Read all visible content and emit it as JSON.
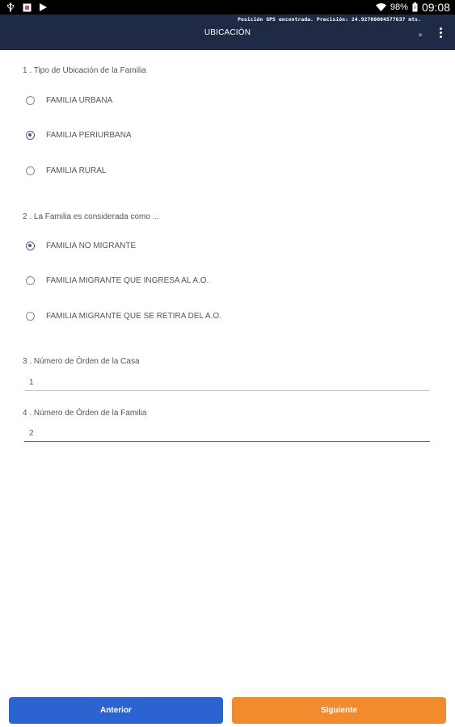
{
  "status_bar": {
    "battery": "98%",
    "time": "09:08"
  },
  "app_bar": {
    "gps_message": "Posición GPS encontrada. Precisión: 24.92700004577637 mts.",
    "title": "UBICACIÓN"
  },
  "questions": [
    {
      "title": "1 . Tipo de Ubicación de la Familia",
      "options": [
        {
          "label": "FAMILIA URBANA",
          "selected": false
        },
        {
          "label": "FAMILIA PERIURBANA",
          "selected": true
        },
        {
          "label": "FAMILIA RURAL",
          "selected": false
        }
      ]
    },
    {
      "title": "2 . La Familia es considerada como ...",
      "options": [
        {
          "label": "FAMILIA NO MIGRANTE",
          "selected": true
        },
        {
          "label": "FAMILIA MIGRANTE QUE INGRESA AL A.O.",
          "selected": false
        },
        {
          "label": "FAMILIA MIGRANTE QUE SE RETIRA DEL A.O.",
          "selected": false
        }
      ]
    },
    {
      "title": "3 . Número de Órden de la Casa",
      "value": "1"
    },
    {
      "title": "4 . Número de Órden de la Familia",
      "value": "2"
    }
  ],
  "footer": {
    "prev_label": "Anterior",
    "next_label": "Siguiente"
  },
  "colors": {
    "app_bar": "#1f2a44",
    "prev_button": "#2b63d0",
    "next_button": "#f28b2d",
    "radio_selected": "#4a5a8c"
  }
}
